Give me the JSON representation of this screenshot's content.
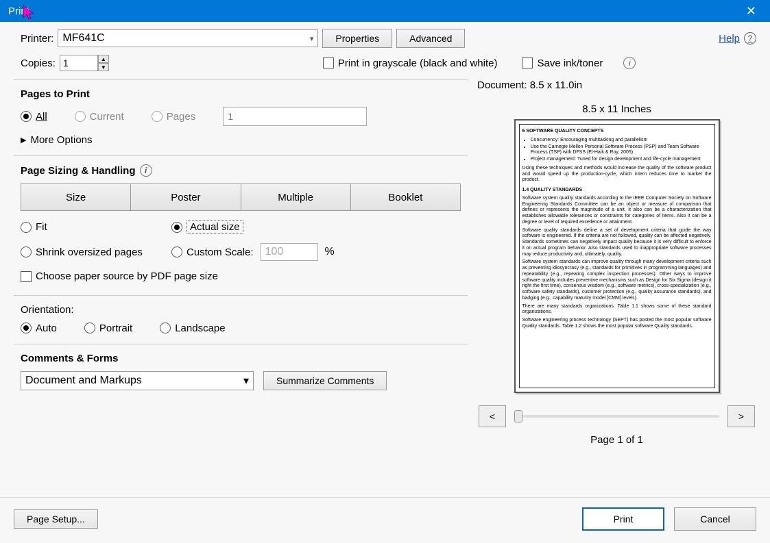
{
  "window": {
    "title": "Print",
    "close_glyph": "✕"
  },
  "header": {
    "printer_label": "Printer:",
    "printer_value": "MF641C",
    "properties_btn": "Properties",
    "advanced_btn": "Advanced",
    "help_label": "Help",
    "copies_label": "Copies:",
    "copies_value": "1",
    "grayscale_label": "Print in grayscale (black and white)",
    "save_ink_label": "Save ink/toner"
  },
  "pages": {
    "title": "Pages to Print",
    "all": "All",
    "current": "Current",
    "pages": "Pages",
    "pages_placeholder": "1",
    "more": "More Options"
  },
  "sizing": {
    "title": "Page Sizing & Handling",
    "btn_size": "Size",
    "btn_poster": "Poster",
    "btn_multiple": "Multiple",
    "btn_booklet": "Booklet",
    "fit": "Fit",
    "actual": "Actual size",
    "shrink": "Shrink oversized pages",
    "custom": "Custom Scale:",
    "custom_value": "100",
    "percent": "%",
    "paper_source": "Choose paper source by PDF page size"
  },
  "orientation": {
    "title": "Orientation:",
    "auto": "Auto",
    "portrait": "Portrait",
    "landscape": "Landscape"
  },
  "comments": {
    "title": "Comments & Forms",
    "value": "Document and Markups",
    "summarize": "Summarize Comments"
  },
  "preview": {
    "document_label": "Document: 8.5 x 11.0in",
    "paper_label": "8.5 x 11 Inches",
    "page_header": "6    SOFTWARE QUALITY CONCEPTS",
    "bullets": [
      "Concurrency: Encouraging multitasking and parallelism",
      "Use the Carnegie Mellon Personal Software Process (PSP) and Team Software Process (TSP) with DFSS (El-Haik & Roy, 2005)",
      "Project management: Tuned for design development and life-cycle management"
    ],
    "para1": "Using these techniques and methods would increase the quality of the software product and would speed up the production-cycle, which intern reduces time to market the product.",
    "sec14": "1.4   QUALITY STANDARDS",
    "para2": "Software system quality standards according to the IEEE Computer Society on Software Engineering Standards Committee can be an object or measure of comparison that defines or represents the magnitude of a unit. It also can be a characterization that establishes allowable tolerances or constraints for categories of items. Also it can be a degree or level of required excellence or attainment.",
    "para3": "Software quality standards define a set of development criteria that guide the way software is engineered. If the criteria are not followed, quality can be affected negatively. Standards sometimes can negatively impact quality because it is very difficult to enforce it on actual program behavior. Also standards used to inappropriate software processes may reduce productivity and, ultimately, quality.",
    "para4": "Software system standards can improve quality through many development criteria such as preventing idiosyncrasy (e.g., standards for primitives in programming languages) and repeatability (e.g., repeating complex inspection processes). Other ways to improve software quality includes preventive mechanisms such as Design for Six Sigma (design it right the first time), consensus wisdom (e.g., software metrics), cross-specialization (e.g., software safety standards), customer protection (e.g., quality assurance standards), and badging (e.g., capability maturity model [CMM] levels).",
    "para5": "There are many standards organizations. Table 1.1 shows some of these standard organizations.",
    "para6": "Software engineering process technology (SEPT) has posted the most popular software Quality standards. Table 1.2 shows the most popular software Quality standards.",
    "prev": "<",
    "next": ">",
    "page_of": "Page 1 of 1"
  },
  "footer": {
    "page_setup": "Page Setup...",
    "print": "Print",
    "cancel": "Cancel"
  }
}
